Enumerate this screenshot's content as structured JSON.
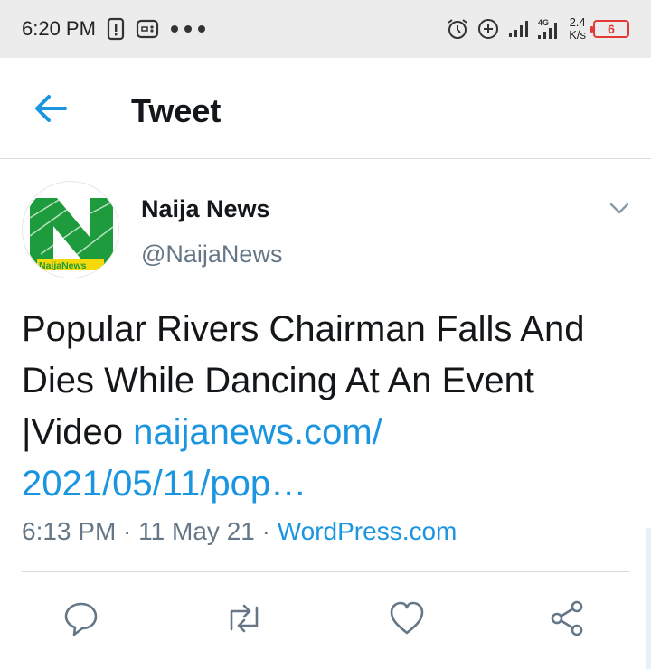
{
  "status_bar": {
    "time": "6:20 PM",
    "icons_left": [
      "alert-icon",
      "gamepad-icon",
      "more-dots-icon"
    ],
    "icons_right": [
      "alarm-icon",
      "data-saver-icon",
      "signal-icon",
      "4g-signal-icon"
    ],
    "net_speed_value": "2.4",
    "net_speed_unit": "K/s",
    "battery_level": "6",
    "battery_color": "#e53935"
  },
  "app_bar": {
    "back_icon": "arrow-left-icon",
    "title": "Tweet"
  },
  "tweet": {
    "author_name": "Naija News",
    "author_handle": "@NaijaNews",
    "avatar_text": "NaijaNews",
    "text": "Popular Rivers Chairman Falls And Dies While Dancing At An Event |Video ",
    "link_text": "naijanews.com/ 2021/05/11/pop…",
    "time": "6:13 PM",
    "separator": " · ",
    "date": "11 May 21",
    "source": "WordPress.com",
    "actions": [
      "reply-icon",
      "retweet-icon",
      "like-icon",
      "share-icon"
    ]
  },
  "colors": {
    "accent": "#1b95e0",
    "secondary_text": "#657786",
    "brand_green": "#1e9b3c"
  }
}
